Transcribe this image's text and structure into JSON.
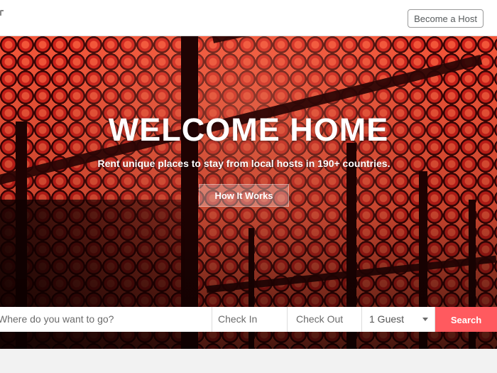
{
  "header": {
    "become_host_label": "Become a Host"
  },
  "hero": {
    "title": "WELCOME HOME",
    "subtitle": "Rent unique places to stay from local hosts in 190+ countries.",
    "cta_label": "How It Works"
  },
  "search": {
    "where_placeholder": "Where do you want to go?",
    "check_in_placeholder": "Check In",
    "check_out_placeholder": "Check Out",
    "guests_value": "1 Guest",
    "search_label": "Search"
  },
  "colors": {
    "accent": "#ff5a5f",
    "hero_red": "#d8231c"
  }
}
